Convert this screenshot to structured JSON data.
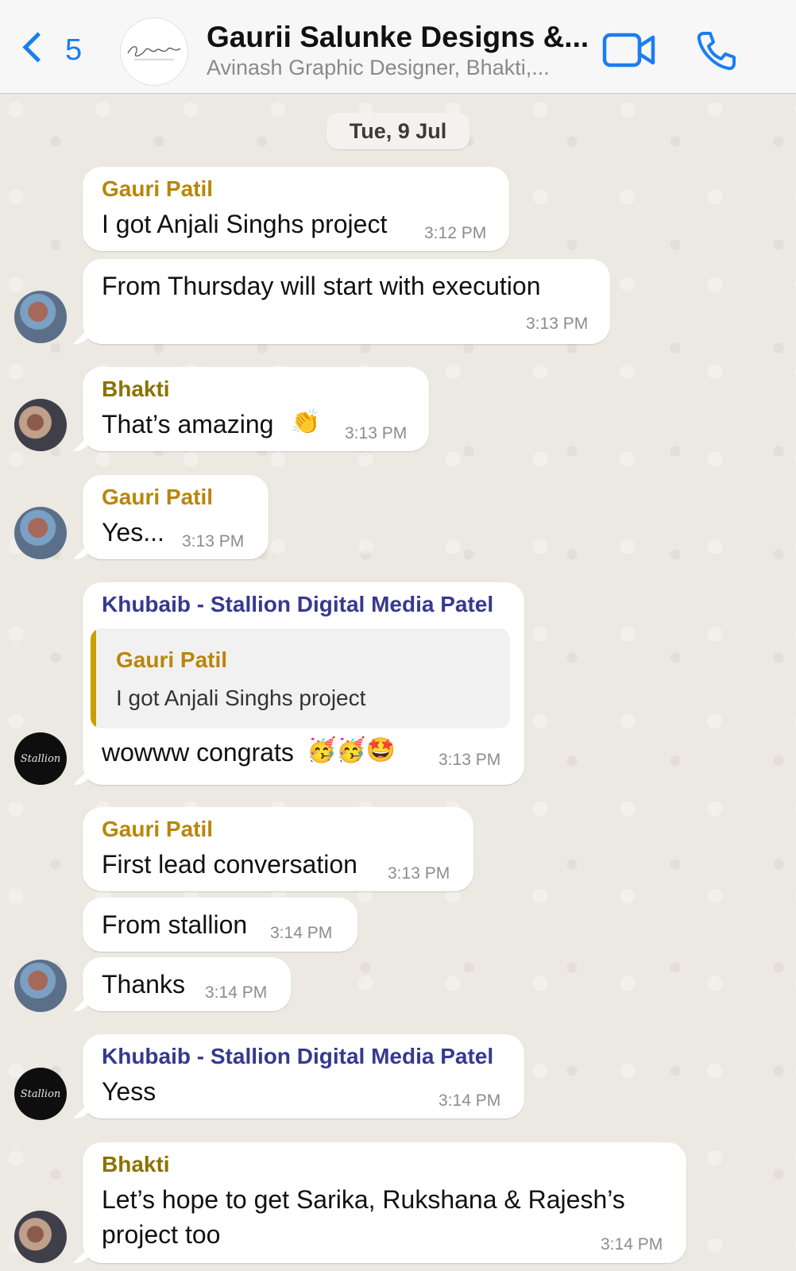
{
  "header": {
    "back_count": "5",
    "title": "Gaurii Salunke Designs &...",
    "subtitle": "Avinash Graphic Designer, Bhakti,...",
    "group_avatar_text": "Gauri Salunke"
  },
  "date_chip": "Tue, 9 Jul",
  "colors": {
    "accent": "#1a7ef0",
    "sender_gauri": "#b8860b",
    "sender_bhakti": "#8a7200",
    "sender_khubaib": "#36398f",
    "bubble": "#ffffff",
    "chat_background": "#ece8e2"
  },
  "messages": [
    {
      "sender": "Gauri Patil",
      "text": "I got Anjali Singhs project",
      "time": "3:12 PM"
    },
    {
      "text": "From Thursday will start with execution",
      "time": "3:13 PM"
    },
    {
      "sender": "Bhakti",
      "text": "That’s amazing",
      "emoji": "👏",
      "time": "3:13 PM"
    },
    {
      "sender": "Gauri Patil",
      "text": "Yes...",
      "time": "3:13 PM"
    },
    {
      "sender": "Khubaib - Stallion Digital Media Patel",
      "quote": {
        "sender": "Gauri Patil",
        "text": "I got Anjali Singhs project"
      },
      "text": "wowww congrats",
      "emoji": "🥳🥳🤩",
      "time": "3:13 PM"
    },
    {
      "sender": "Gauri Patil",
      "text": "First lead conversation",
      "time": "3:13 PM"
    },
    {
      "text": "From stallion",
      "time": "3:14 PM"
    },
    {
      "text": "Thanks",
      "time": "3:14 PM"
    },
    {
      "sender": "Khubaib - Stallion Digital Media Patel",
      "text": "Yess",
      "time": "3:14 PM"
    },
    {
      "sender": "Bhakti",
      "text_line1": "Let’s hope to get Sarika, Rukshana & Rajesh’s",
      "text_line2": "project too",
      "time": "3:14 PM"
    }
  ],
  "avatars": {
    "stallion_label": "Stallion"
  },
  "icons": [
    "chevron-left-icon",
    "video-camera-icon",
    "phone-icon"
  ]
}
